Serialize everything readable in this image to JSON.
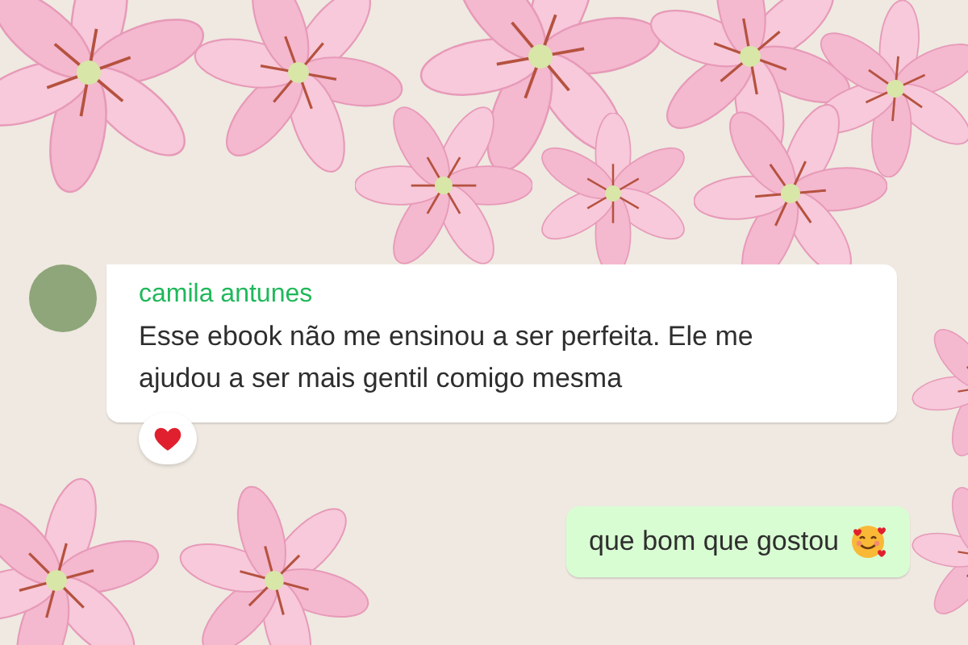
{
  "messages": [
    {
      "kind": "incoming",
      "sender": "camila antunes",
      "text": "Esse ebook não me ensinou a ser perfeita. Ele me ajudou a ser mais gentil comigo mesma",
      "reaction": {
        "kind": "heart"
      }
    },
    {
      "kind": "outgoing",
      "text": "que bom que gostou",
      "emoji": {
        "kind": "smiling-hearts"
      }
    }
  ]
}
